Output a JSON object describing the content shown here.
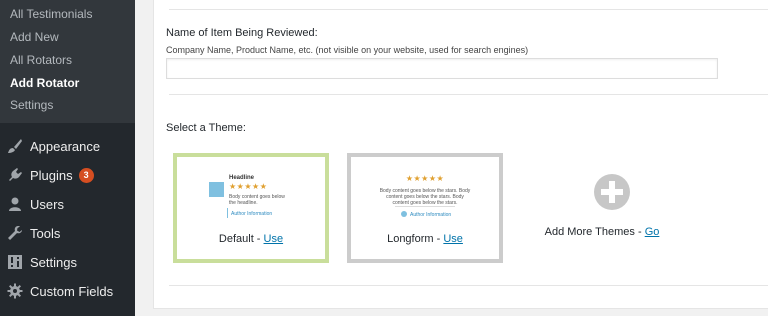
{
  "sidebar": {
    "submenu": [
      {
        "label": "All Testimonials"
      },
      {
        "label": "Add New"
      },
      {
        "label": "All Rotators"
      },
      {
        "label": "Add Rotator",
        "current": true
      },
      {
        "label": "Settings"
      }
    ],
    "menu": [
      {
        "label": "Appearance",
        "icon": "paintbrush-icon"
      },
      {
        "label": "Plugins",
        "icon": "plug-icon",
        "badge": "3"
      },
      {
        "label": "Users",
        "icon": "user-icon"
      },
      {
        "label": "Tools",
        "icon": "wrench-icon"
      },
      {
        "label": "Settings",
        "icon": "settings-sliders-icon"
      },
      {
        "label": "Custom Fields",
        "icon": "gear-icon"
      }
    ]
  },
  "form": {
    "item_label": "Name of Item Being Reviewed:",
    "item_description": "Company Name, Product Name, etc. (not visible on your website, used for search engines)",
    "item_value": "",
    "theme_label": "Select a Theme:"
  },
  "themes": [
    {
      "name": "Default",
      "link": "Use",
      "selected": true,
      "preview": {
        "headline": "Headline",
        "stars": "★★★★★",
        "body": "Body content goes below the headline.",
        "author": "Author Information"
      }
    },
    {
      "name": "Longform",
      "link": "Use",
      "selected": false,
      "preview": {
        "stars": "★★★★★",
        "body": "Body content goes below the stars. Body content goes below the stars. Body content goes below the stars.",
        "author": "Author Information"
      }
    }
  ],
  "add_more": {
    "label": "Add More Themes",
    "link": "Go"
  },
  "colors": {
    "sidebar_bg": "#23282d",
    "submenu_bg": "#32373c",
    "badge": "#d54e21",
    "link": "#0073aa",
    "selected_border": "#c9de9b",
    "unselected_border": "#cccccc"
  }
}
